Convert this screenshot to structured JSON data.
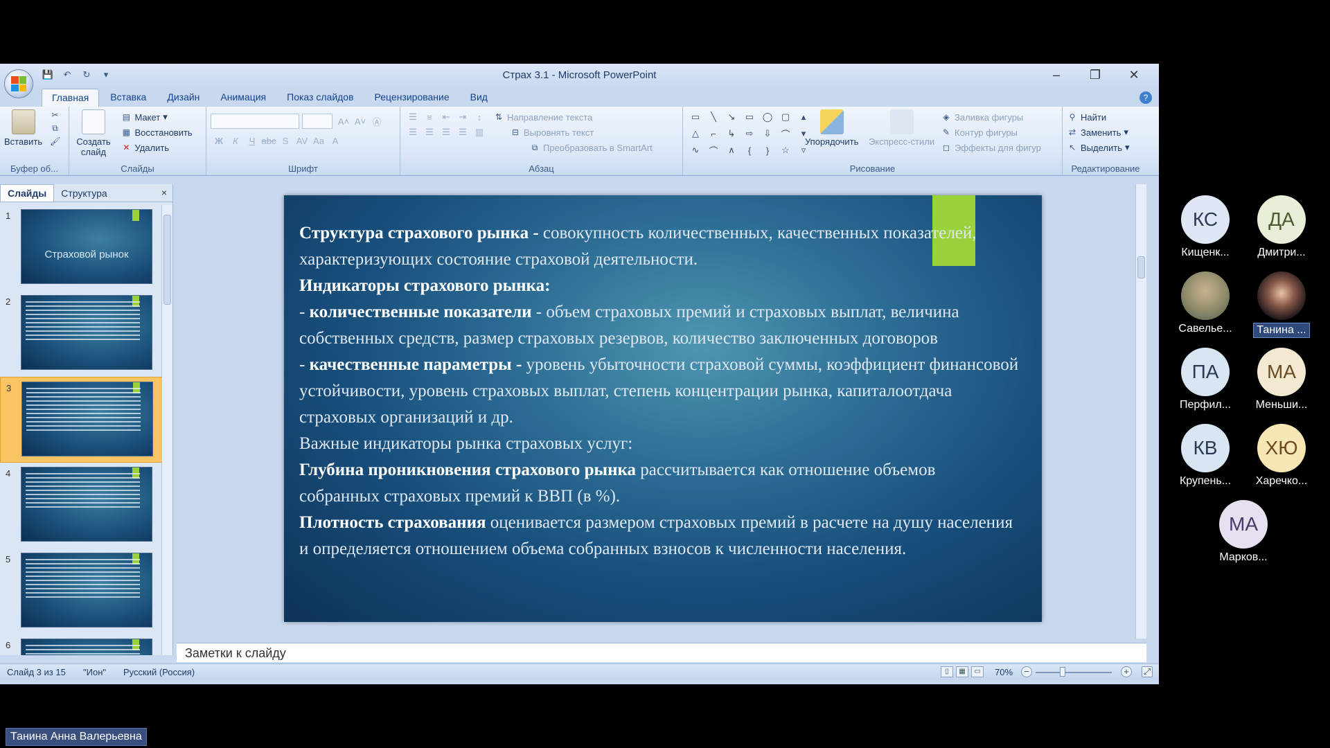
{
  "window": {
    "title": "Страх 3.1 - Microsoft PowerPoint"
  },
  "qat": {
    "icons": [
      "save-icon",
      "undo-icon",
      "redo-icon",
      "customize-icon"
    ]
  },
  "tabs": [
    "Главная",
    "Вставка",
    "Дизайн",
    "Анимация",
    "Показ слайдов",
    "Рецензирование",
    "Вид"
  ],
  "active_tab": "Главная",
  "ribbon": {
    "clipboard": {
      "label": "Буфер об...",
      "paste": "Вставить"
    },
    "slides": {
      "label": "Слайды",
      "new_slide": "Создать слайд",
      "layout": "Макет",
      "reset": "Восстановить",
      "delete": "Удалить"
    },
    "font": {
      "label": "Шрифт"
    },
    "paragraph": {
      "label": "Абзац",
      "text_direction": "Направление текста",
      "align_text": "Выровнять текст",
      "convert_smartart": "Преобразовать в SmartArt"
    },
    "drawing": {
      "label": "Рисование",
      "arrange": "Упорядочить",
      "quick_styles": "Экспресс-стили",
      "shape_fill": "Заливка фигуры",
      "shape_outline": "Контур фигуры",
      "shape_effects": "Эффекты для фигур"
    },
    "editing": {
      "label": "Редактирование",
      "find": "Найти",
      "replace": "Заменить",
      "select": "Выделить"
    }
  },
  "left_pane": {
    "tabs": [
      "Слайды",
      "Структура"
    ],
    "close": "×",
    "slides": [
      {
        "num": "1",
        "title": "Страховой рынок"
      },
      {
        "num": "2"
      },
      {
        "num": "3",
        "selected": true
      },
      {
        "num": "4"
      },
      {
        "num": "5"
      },
      {
        "num": "6"
      }
    ]
  },
  "slide": {
    "p1_bold": "Структура страхового рынка -",
    "p1_text": " совокупность количественных, качественных показателей, характеризующих состояние страховой деятельности.",
    "p2_bold": "Индикаторы страхового рынка:",
    "p3_prefix": "- ",
    "p3_bold": "количественные показатели",
    "p3_text": " -  объем страховых премий и страховых выплат, величина собственных средств, размер страховых резервов, количество заключенных договоров",
    "p4_prefix": "- ",
    "p4_bold": "качественные параметры -",
    "p4_text": " уровень убыточности страховой суммы, коэффициент финансовой устойчивости, уровень страховых выплат, степень концентрации рынка, капиталоотдача страховых организаций и др.",
    "p5_text": "Важные индикаторы рынка страховых услуг:",
    "p6_bold": "Глубина проникновения страхового рынка",
    "p6_text": " рассчитывается как отношение объемов собранных страховых премий к ВВП (в %).",
    "p7_bold": "Плотность страхования",
    "p7_text": " оценивается размером страховых премий в расчете на душу населения и определяется отношением объема собранных взносов к численности населения.",
    "accent_color": "#9bd13b"
  },
  "notes": {
    "placeholder": "Заметки к слайду"
  },
  "status": {
    "slide_info": "Слайд 3 из 15",
    "theme": "\"Ион\"",
    "language": "Русский (Россия)",
    "zoom": "70%"
  },
  "participants": [
    {
      "initials": "КС",
      "name": "Кищенк...",
      "color": "#dfe6f5",
      "text_color": "#2d3a55"
    },
    {
      "initials": "ДА",
      "name": "Дмитри...",
      "color": "#e8efd8",
      "text_color": "#4a5a2a"
    },
    {
      "initials": "",
      "name": "Савелье...",
      "color": "#8c8a6a",
      "photo": true
    },
    {
      "initials": "",
      "name": "Танина ...",
      "color": "#3d3340",
      "photo": true,
      "active": true
    },
    {
      "initials": "ПА",
      "name": "Перфил...",
      "color": "#d8e6f3",
      "text_color": "#2d3a55"
    },
    {
      "initials": "МА",
      "name": "Меньши...",
      "color": "#f3e8d0",
      "text_color": "#6a4a20"
    },
    {
      "initials": "КВ",
      "name": "Крупень...",
      "color": "#d8e6f3",
      "text_color": "#2d3a55"
    },
    {
      "initials": "ХЮ",
      "name": "Харечко...",
      "color": "#f7e7b5",
      "text_color": "#6a4a20"
    },
    {
      "initials": "МА",
      "name": "Марков...",
      "color": "#e6e0f0",
      "text_color": "#4a3a6a"
    }
  ],
  "speaker": "Танина Анна Валерьевна"
}
